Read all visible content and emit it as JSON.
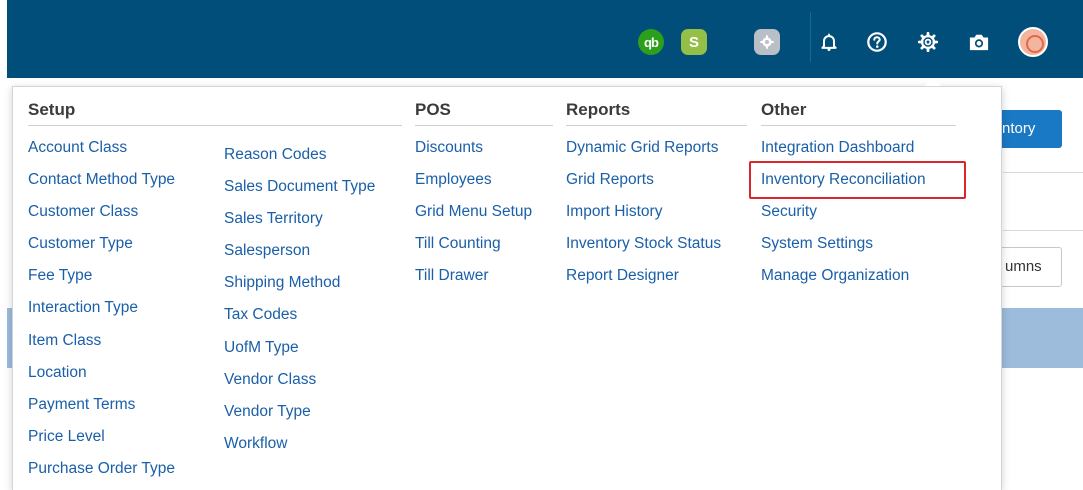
{
  "topbar": {
    "icons": [
      {
        "name": "quickbooks-icon",
        "glyph": "qb"
      },
      {
        "name": "shopify-icon",
        "glyph": "S"
      },
      {
        "name": "extension-gear-icon"
      },
      {
        "name": "bell-icon"
      },
      {
        "name": "help-icon"
      },
      {
        "name": "gear-icon"
      },
      {
        "name": "camera-icon"
      },
      {
        "name": "avatar"
      }
    ]
  },
  "background": {
    "primary_button_label": "ntory",
    "columns_button_label": "umns"
  },
  "menu": {
    "setup": {
      "heading": "Setup",
      "col1": [
        "Account Class",
        "Contact Method Type",
        "Customer Class",
        "Customer Type",
        "Fee Type",
        "Interaction Type",
        "Item Class",
        "Location",
        "Payment Terms",
        "Price Level",
        "Purchase Order Type"
      ],
      "col2": [
        "Reason Codes",
        "Sales Document Type",
        "Sales Territory",
        "Salesperson",
        "Shipping Method",
        "Tax Codes",
        "UofM Type",
        "Vendor Class",
        "Vendor Type",
        "Workflow"
      ]
    },
    "pos": {
      "heading": "POS",
      "items": [
        "Discounts",
        "Employees",
        "Grid Menu Setup",
        "Till Counting",
        "Till Drawer"
      ]
    },
    "reports": {
      "heading": "Reports",
      "items": [
        "Dynamic Grid Reports",
        "Grid Reports",
        "Import History",
        "Inventory Stock Status",
        "Report Designer"
      ]
    },
    "other": {
      "heading": "Other",
      "items": [
        "Integration Dashboard",
        "Inventory Reconciliation",
        "Security",
        "System Settings",
        "Manage Organization"
      ]
    }
  },
  "colors": {
    "topbar": "#024e7a",
    "link": "#1a5fa8",
    "highlight": "#d9262c"
  }
}
